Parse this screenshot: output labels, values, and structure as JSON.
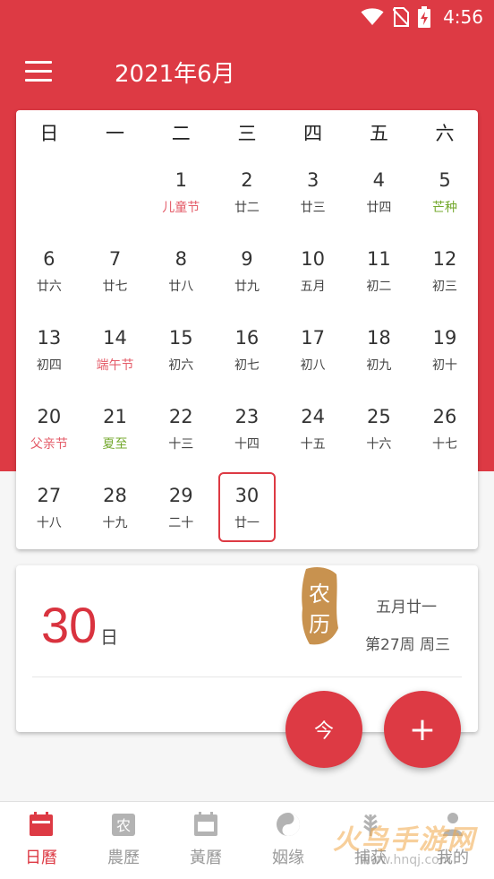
{
  "status_bar": {
    "time": "4:56"
  },
  "app_bar": {
    "title": "2021年6月"
  },
  "weekdays": [
    "日",
    "一",
    "二",
    "三",
    "四",
    "五",
    "六"
  ],
  "days": [
    {
      "num": "1",
      "sub": "儿童节",
      "type": "festival"
    },
    {
      "num": "2",
      "sub": "廿二"
    },
    {
      "num": "3",
      "sub": "廿三"
    },
    {
      "num": "4",
      "sub": "廿四"
    },
    {
      "num": "5",
      "sub": "芒种",
      "type": "term"
    },
    {
      "num": "6",
      "sub": "廿六"
    },
    {
      "num": "7",
      "sub": "廿七"
    },
    {
      "num": "8",
      "sub": "廿八"
    },
    {
      "num": "9",
      "sub": "廿九"
    },
    {
      "num": "10",
      "sub": "五月"
    },
    {
      "num": "11",
      "sub": "初二"
    },
    {
      "num": "12",
      "sub": "初三"
    },
    {
      "num": "13",
      "sub": "初四"
    },
    {
      "num": "14",
      "sub": "端午节",
      "type": "festival"
    },
    {
      "num": "15",
      "sub": "初六"
    },
    {
      "num": "16",
      "sub": "初七"
    },
    {
      "num": "17",
      "sub": "初八"
    },
    {
      "num": "18",
      "sub": "初九"
    },
    {
      "num": "19",
      "sub": "初十"
    },
    {
      "num": "20",
      "sub": "父亲节",
      "type": "festival"
    },
    {
      "num": "21",
      "sub": "夏至",
      "type": "term"
    },
    {
      "num": "22",
      "sub": "十三"
    },
    {
      "num": "23",
      "sub": "十四"
    },
    {
      "num": "24",
      "sub": "十五"
    },
    {
      "num": "25",
      "sub": "十六"
    },
    {
      "num": "26",
      "sub": "十七"
    },
    {
      "num": "27",
      "sub": "十八"
    },
    {
      "num": "28",
      "sub": "十九"
    },
    {
      "num": "29",
      "sub": "二十"
    },
    {
      "num": "30",
      "sub": "廿一",
      "today": true
    }
  ],
  "first_weekday_index": 2,
  "detail": {
    "day": "30",
    "day_unit": "日",
    "stamp_text_1": "农",
    "stamp_text_2": "历",
    "lunar_date": "五月廿一",
    "week_info": "第27周 周三"
  },
  "fab": {
    "today_label": "今",
    "add_label": "+"
  },
  "bottom_nav": [
    {
      "label": "日曆",
      "icon": "calendar-icon",
      "active": true
    },
    {
      "label": "農歷",
      "icon": "nongli-icon",
      "icon_text": "农"
    },
    {
      "label": "黃曆",
      "icon": "almanac-icon"
    },
    {
      "label": "姻缘",
      "icon": "yin-yang-icon"
    },
    {
      "label": "捕获",
      "icon": "wheat-icon"
    },
    {
      "label": "我的",
      "icon": "person-icon"
    }
  ],
  "watermark": {
    "title": "火鸟手游网",
    "url": "www.hnqj.com"
  },
  "colors": {
    "primary": "#dd3a44",
    "festival": "#e45c69",
    "term": "#74a82d"
  }
}
